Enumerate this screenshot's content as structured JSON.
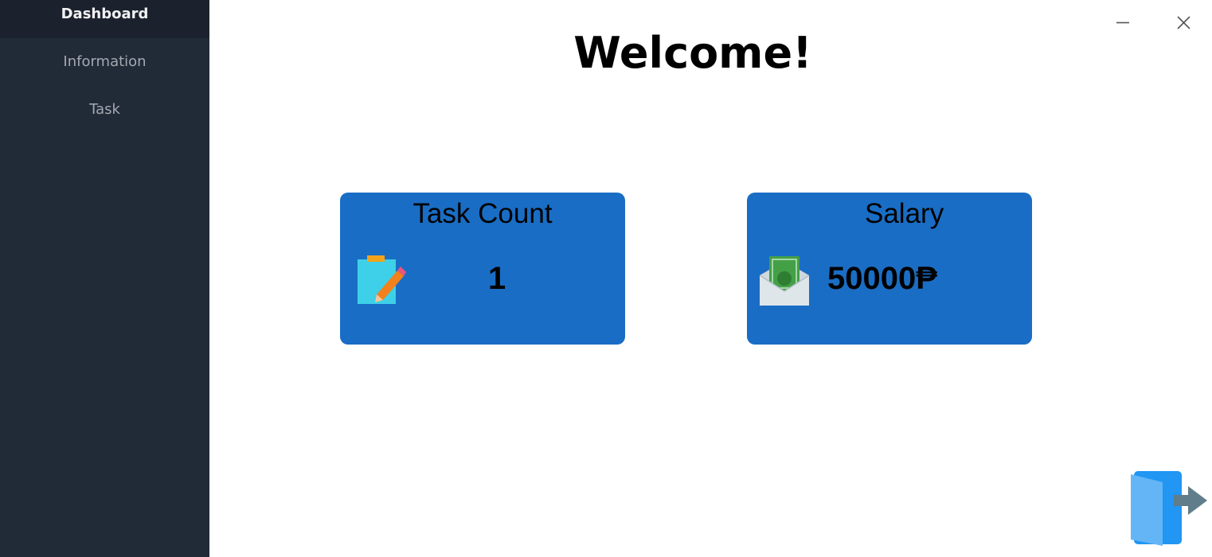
{
  "sidebar": {
    "items": [
      {
        "label": "Dashboard",
        "active": true
      },
      {
        "label": "Information",
        "active": false
      },
      {
        "label": "Task",
        "active": false
      }
    ],
    "background": "#212a37"
  },
  "main": {
    "title": "Welcome!",
    "cards": [
      {
        "title": "Task Count",
        "value": "1",
        "icon": "clipboard-pencil-icon"
      },
      {
        "title": "Salary",
        "value": "50000₱",
        "icon": "money-envelope-icon"
      }
    ],
    "card_color": "#1a6dc4"
  },
  "window_controls": {
    "minimize_icon": "minimize-icon",
    "close_icon": "close-icon"
  },
  "logout_icon": "logout-door-icon"
}
